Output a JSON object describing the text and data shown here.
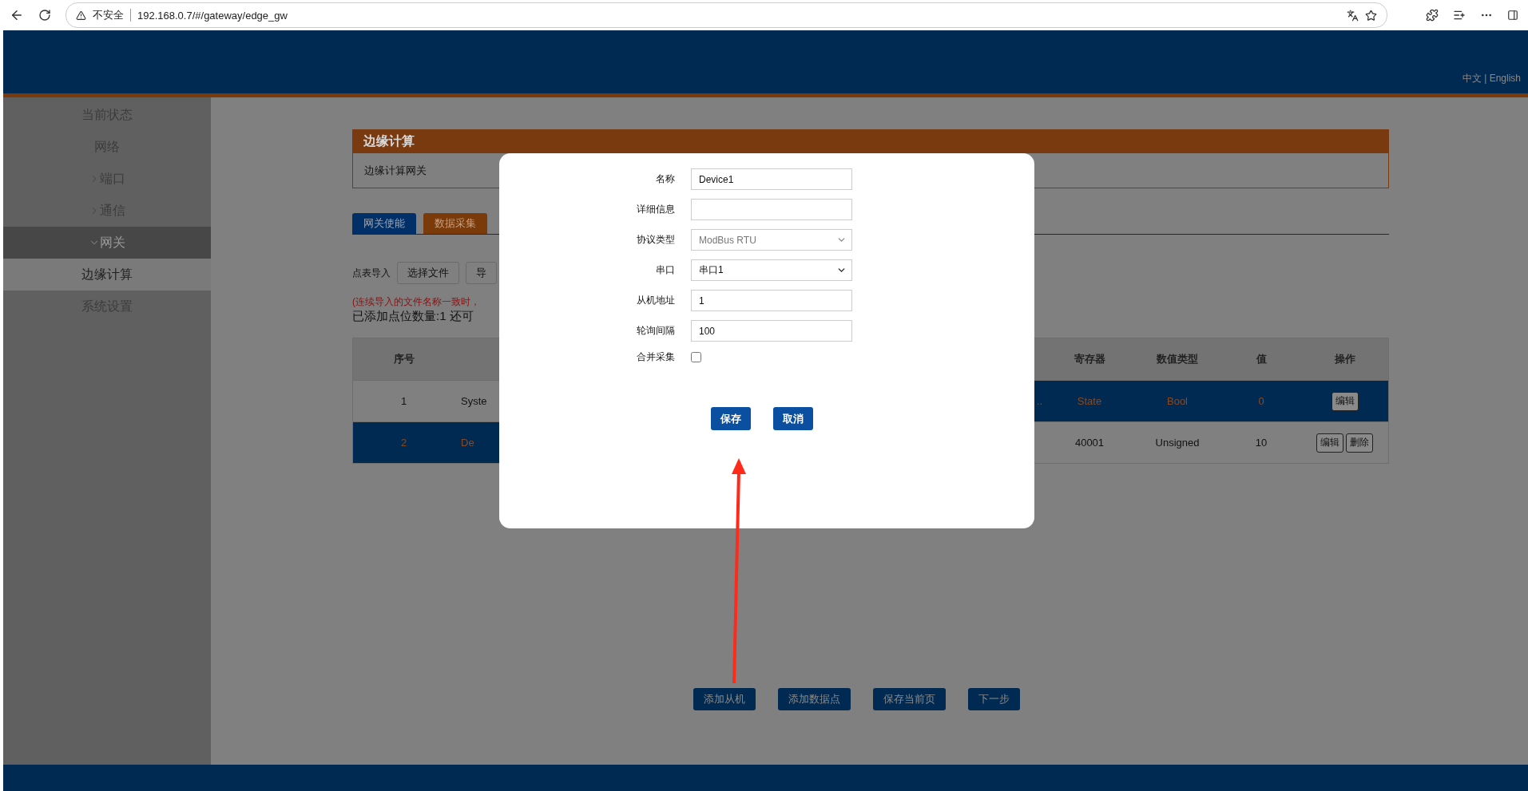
{
  "browser": {
    "security": "不安全",
    "url": "192.168.0.7/#/gateway/edge_gw"
  },
  "header": {
    "language": "中文 | English"
  },
  "sidebar": {
    "items": [
      {
        "label": "当前状态",
        "selected": false
      },
      {
        "label": "网络",
        "selected": false
      },
      {
        "label": "端口",
        "selected": false,
        "expanded": false
      },
      {
        "label": "通信",
        "selected": false,
        "expanded": false
      },
      {
        "label": "网关",
        "selected": false,
        "expanded": true,
        "children": [
          {
            "label": "边缘计算",
            "selected": true
          }
        ]
      },
      {
        "label": "系统设置",
        "selected": false
      }
    ]
  },
  "panel": {
    "title": "边缘计算",
    "body": "边缘计算网关"
  },
  "tabs": [
    {
      "label": "网关使能",
      "selected": false
    },
    {
      "label": "数据采集",
      "selected": true
    }
  ],
  "import": {
    "label": "点表导入",
    "buttons": [
      "选择文件",
      "导"
    ]
  },
  "notice": "(连续导入的文件名称一致时，",
  "count_text": "已添加点位数量:1  还可",
  "table": {
    "header_left": [
      "序号"
    ],
    "header_right": [
      "寄存器",
      "数值类型",
      "值",
      "操作"
    ],
    "rows": [
      {
        "number": "1",
        "name": "Syste",
        "column_4": "..",
        "register": "State",
        "value_type": "Bool",
        "value": "0",
        "actions": [
          "编辑"
        ],
        "highlight_left": false,
        "highlight_right": true
      },
      {
        "number": "2",
        "name": "De",
        "register": "40001",
        "value_type": "Unsigned",
        "value": "10",
        "actions": [
          "编辑",
          "删除"
        ],
        "highlight_left": true,
        "highlight_right": false
      }
    ]
  },
  "footer_buttons": [
    "添加从机",
    "添加数据点",
    "保存当前页",
    "下一步"
  ],
  "modal": {
    "fields": [
      {
        "kind": "text",
        "label": "名称",
        "value": "Device1"
      },
      {
        "kind": "text",
        "label": "详细信息"
      },
      {
        "kind": "select",
        "label": "协议类型",
        "value": "ModBus RTU",
        "disabled": true
      },
      {
        "kind": "select",
        "label": "串口",
        "value": "串口1",
        "disabled": false
      },
      {
        "kind": "text",
        "label": "从机地址",
        "value": "1"
      },
      {
        "kind": "text",
        "label": "轮询间隔",
        "value": "100"
      },
      {
        "kind": "checkbox",
        "label": "合并采集",
        "checked": false
      }
    ],
    "buttons": [
      "保存",
      "取消"
    ]
  }
}
